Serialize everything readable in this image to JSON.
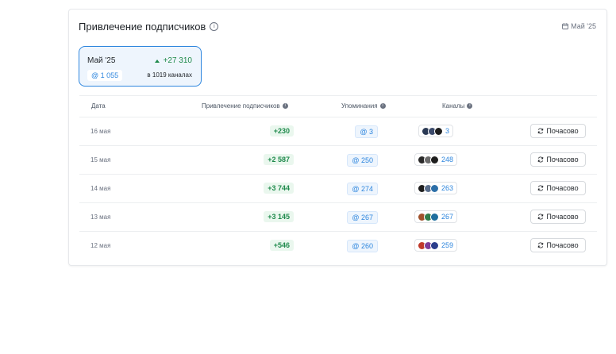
{
  "widget": {
    "title": "Привлечение подписчиков",
    "period": "Май '25"
  },
  "summary": {
    "month": "Май '25",
    "growth": "+27 310",
    "mentions": "@ 1 055",
    "channels": "в 1019 каналах"
  },
  "table": {
    "headers": {
      "date": "Дата",
      "growth": "Привлечение подписчиков",
      "mentions": "Упоминания",
      "channels": "Каналы"
    },
    "rows": [
      {
        "date": "16 мая",
        "growth": "+230",
        "mentions": "@ 3",
        "channels": "3",
        "action": "Почасово",
        "avatars": [
          "#2b3a55",
          "#3b4a6b",
          "#1e1e1e"
        ]
      },
      {
        "date": "15 мая",
        "growth": "+2 587",
        "mentions": "@ 250",
        "channels": "248",
        "action": "Почасово",
        "avatars": [
          "#2a2a2a",
          "#6b6b6b",
          "#1e1e1e"
        ]
      },
      {
        "date": "14 мая",
        "growth": "+3 744",
        "mentions": "@ 274",
        "channels": "263",
        "action": "Почасово",
        "avatars": [
          "#1e1e1e",
          "#5a6e8c",
          "#2d6fa8"
        ]
      },
      {
        "date": "13 мая",
        "growth": "+3 145",
        "mentions": "@ 267",
        "channels": "267",
        "action": "Почасово",
        "avatars": [
          "#a0522d",
          "#2f7d4a",
          "#1e6e9e"
        ]
      },
      {
        "date": "12 мая",
        "growth": "+546",
        "mentions": "@ 260",
        "channels": "259",
        "action": "Почасово",
        "avatars": [
          "#c0392b",
          "#7d3c98",
          "#2c3e8c"
        ]
      }
    ]
  }
}
